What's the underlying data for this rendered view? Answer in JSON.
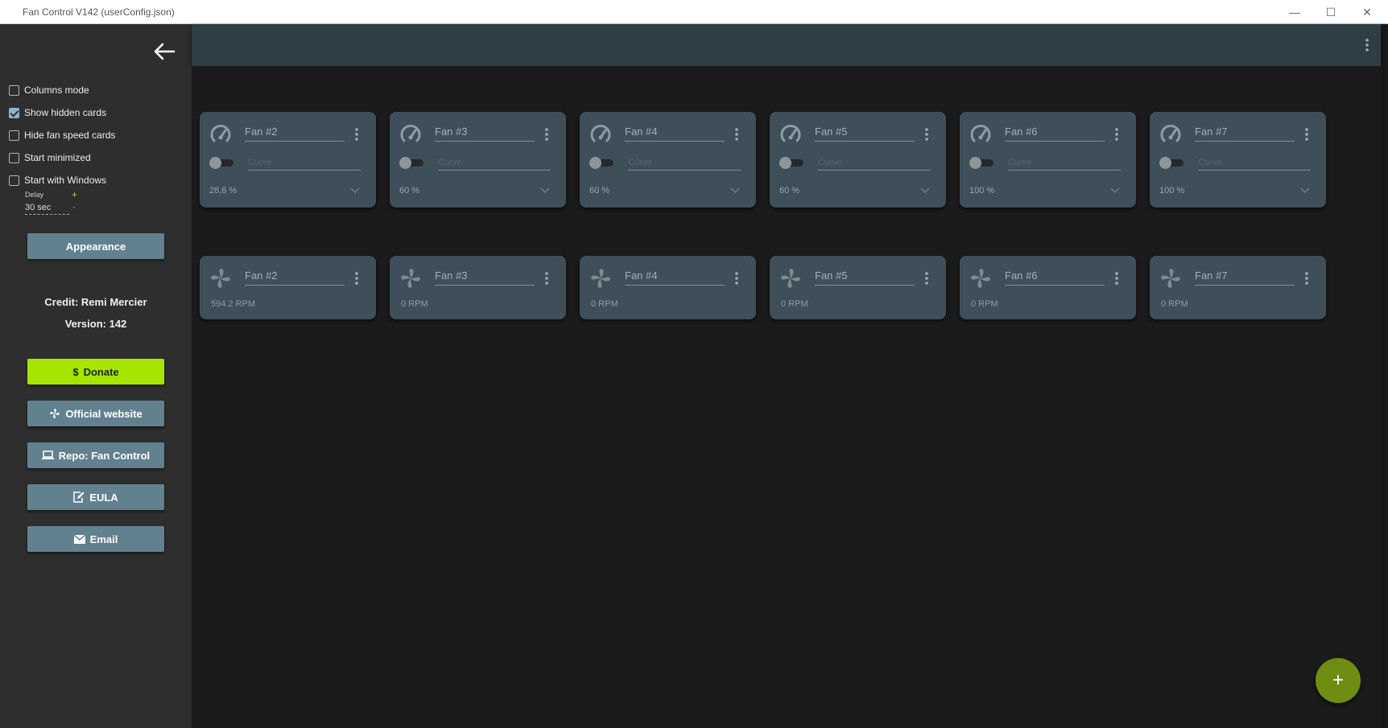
{
  "window": {
    "title": "Fan Control V142 (userConfig.json)"
  },
  "sidebar": {
    "options": [
      {
        "label": "Columns mode",
        "checked": false
      },
      {
        "label": "Show hidden cards",
        "checked": true
      },
      {
        "label": "Hide fan speed cards",
        "checked": false
      },
      {
        "label": "Start minimized",
        "checked": false
      },
      {
        "label": "Start with Windows",
        "checked": false
      }
    ],
    "delay": {
      "label": "Delay",
      "value": "30 sec",
      "plus": "+",
      "minus": "-"
    },
    "appearance_label": "Appearance",
    "credit": "Credit: Remi Mercier",
    "version": "Version: 142",
    "buttons": {
      "donate": "Donate",
      "website": "Official website",
      "repo": "Repo: Fan Control",
      "eula": "EULA",
      "email": "Email"
    }
  },
  "control_cards": [
    {
      "name": "Fan #2",
      "curve": "Curve",
      "value": "28,6 %"
    },
    {
      "name": "Fan #3",
      "curve": "Curve",
      "value": "60 %"
    },
    {
      "name": "Fan #4",
      "curve": "Curve",
      "value": "60 %"
    },
    {
      "name": "Fan #5",
      "curve": "Curve",
      "value": "60 %"
    },
    {
      "name": "Fan #6",
      "curve": "Curve",
      "value": "100 %"
    },
    {
      "name": "Fan #7",
      "curve": "Curve",
      "value": "100 %"
    }
  ],
  "speed_cards": [
    {
      "name": "Fan #2",
      "value": "594.2 RPM"
    },
    {
      "name": "Fan #3",
      "value": "0 RPM"
    },
    {
      "name": "Fan #4",
      "value": "0 RPM"
    },
    {
      "name": "Fan #5",
      "value": "0 RPM"
    },
    {
      "name": "Fan #6",
      "value": "0 RPM"
    },
    {
      "name": "Fan #7",
      "value": "0 RPM"
    }
  ],
  "fab": {
    "label": "+"
  },
  "colors": {
    "accent": "#a6e500",
    "card": "#3e4f5a",
    "topbar": "#2f3d47",
    "sidebar": "#2e2e2e",
    "button": "#62818f"
  },
  "icons": [
    "back-arrow-icon",
    "gauge-icon",
    "fan-icon",
    "kebab-menu-icon",
    "chevron-down-icon",
    "dollar-icon",
    "laptop-icon",
    "edit-document-icon",
    "mail-icon",
    "minimize-icon",
    "maximize-icon",
    "close-icon",
    "plus-icon"
  ]
}
